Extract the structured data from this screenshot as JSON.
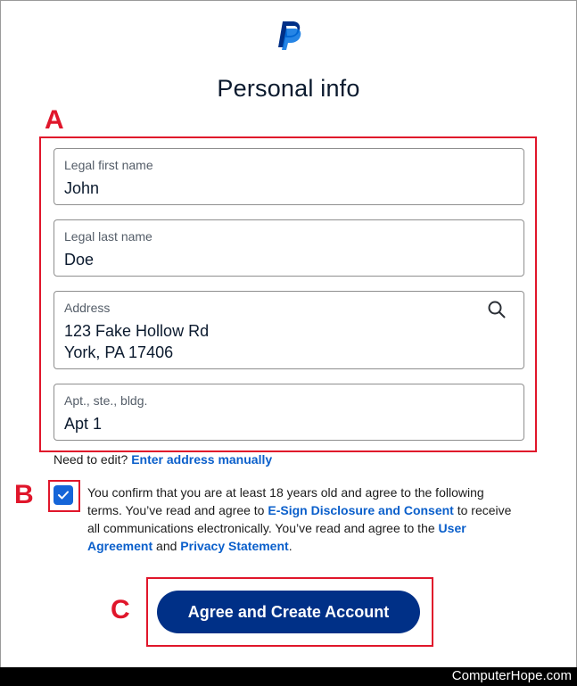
{
  "header": {
    "logo_icon": "paypal-logo-icon",
    "title": "Personal info"
  },
  "annotations": {
    "a": "A",
    "b": "B",
    "c": "C",
    "color": "#e0162b"
  },
  "fields": [
    {
      "label": "Legal first name",
      "value": "John"
    },
    {
      "label": "Legal last name",
      "value": "Doe"
    },
    {
      "label": "Address",
      "value_line1": "123 Fake Hollow Rd",
      "value_line2": "York, PA 17406",
      "icon": "search-icon"
    },
    {
      "label": "Apt., ste., bldg.",
      "value": "Apt 1"
    }
  ],
  "edit": {
    "prefix": "Need to edit?",
    "link": "Enter address manually"
  },
  "consent": {
    "checked": true,
    "text1": "You confirm that you are at least 18 years old and agree to the following terms. You’ve read and agree to",
    "link1": "E-Sign Disclosure and Consent",
    "text2": "to receive all communications electronically. You’ve read and agree to the",
    "link2": "User Agreement",
    "text3": "and",
    "link3": "Privacy Statement",
    "text4": "."
  },
  "cta": {
    "label": "Agree and Create Account"
  },
  "footer": {
    "brand": "ComputerHope.com"
  },
  "colors": {
    "brand_dark": "#003087",
    "link": "#0a5fcb",
    "checkbox": "#1565d8"
  }
}
